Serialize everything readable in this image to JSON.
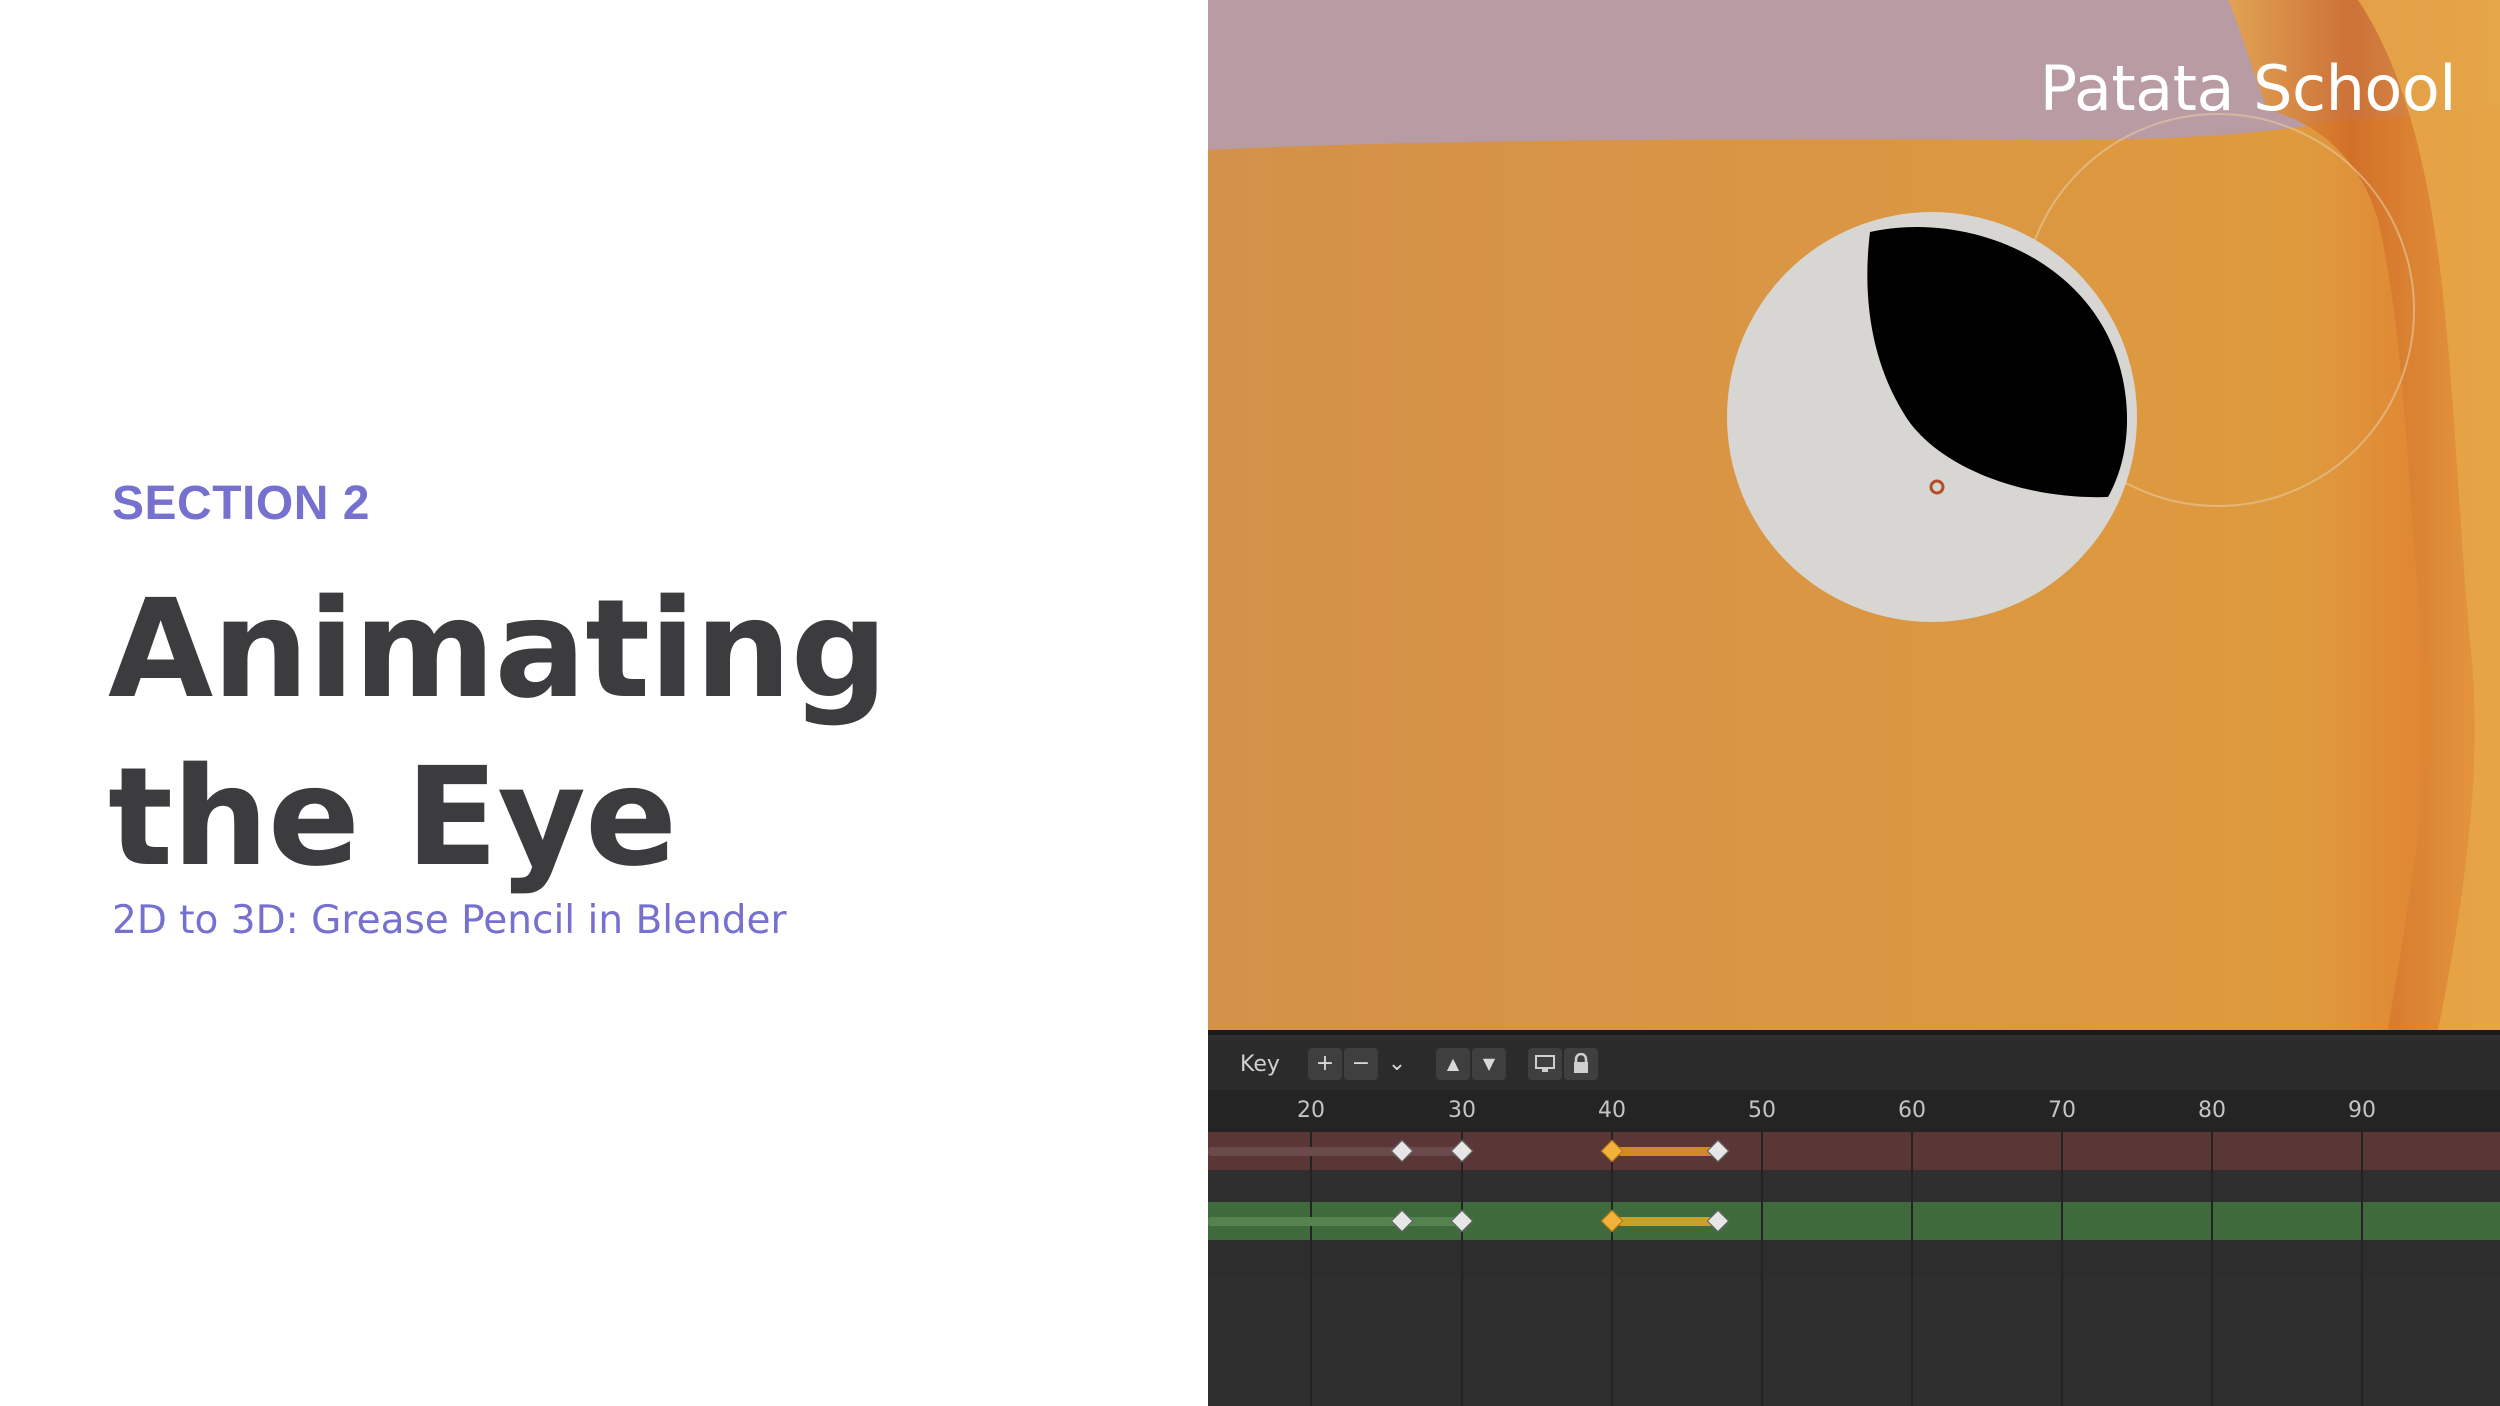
{
  "slide": {
    "section_label": "SECTION 2",
    "title": "Animating the Eye",
    "subtitle": "2D to 3D: Grease Pencil in Blender"
  },
  "viewport": {
    "brand": "Patata School"
  },
  "timeline": {
    "key_label": "Key",
    "buttons": {
      "add": "+",
      "remove": "−",
      "dropdown": "⌄",
      "up": "▲",
      "down": "▼"
    },
    "frame_labels": [
      "20",
      "30",
      "40",
      "50",
      "60",
      "70",
      "80",
      "90"
    ],
    "colors": {
      "selected_key": "#f1b23a",
      "red_channel": "#5a3637",
      "green_channel": "#3f6a3b"
    }
  }
}
